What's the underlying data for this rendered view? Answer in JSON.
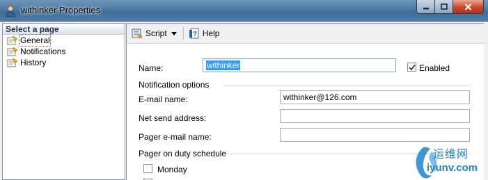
{
  "window": {
    "title": "withinker Properties"
  },
  "sidebar": {
    "header": "Select a page",
    "items": [
      {
        "label": "General"
      },
      {
        "label": "Notifications"
      },
      {
        "label": "History"
      }
    ]
  },
  "toolbar": {
    "script_label": "Script",
    "help_label": "Help"
  },
  "form": {
    "name_label": "Name:",
    "name_value": "withinker",
    "enabled_label": "Enabled",
    "enabled_checked": true,
    "notification_group": "Notification options",
    "email_label": "E-mail name:",
    "email_value": "withinker@126.com",
    "netsend_label": "Net send address:",
    "netsend_value": "",
    "pager_email_label": "Pager e-mail name:",
    "pager_email_value": "",
    "schedule_group": "Pager on duty schedule",
    "monday_label": "Monday",
    "monday_checked": false
  },
  "watermark": {
    "cn": "运维网",
    "en": "iyunv.com"
  },
  "colors": {
    "titlebar": "#4d7aa3",
    "selection": "#3399ff",
    "close_button": "#c8472c"
  }
}
